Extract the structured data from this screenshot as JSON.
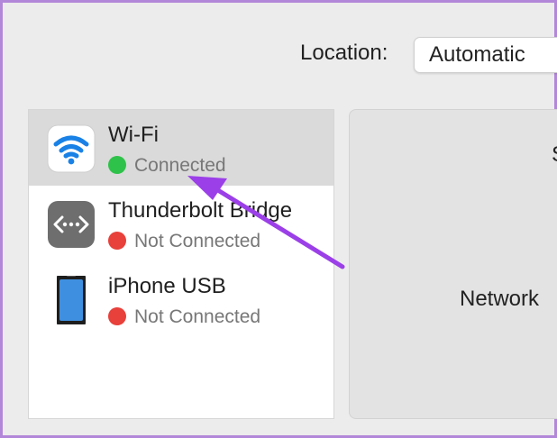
{
  "toolbar": {
    "location_label": "Location:",
    "location_value": "Automatic"
  },
  "services": [
    {
      "name": "Wi-Fi",
      "status": "Connected",
      "status_color": "#2fc24a",
      "icon": "wifi-icon",
      "selected": true
    },
    {
      "name": "Thunderbolt Bridge",
      "status": "Not Connected",
      "status_color": "#e8403a",
      "icon": "thunderbolt-bridge-icon",
      "selected": false
    },
    {
      "name": "iPhone USB",
      "status": "Not Connected",
      "status_color": "#e8403a",
      "icon": "iphone-icon",
      "selected": false
    }
  ],
  "detail": {
    "partial_status": "S",
    "network_label": "Network"
  },
  "colors": {
    "accent": "#1a82e6",
    "annotation_arrow": "#9b3fe8",
    "frame_border": "#b286d8"
  }
}
